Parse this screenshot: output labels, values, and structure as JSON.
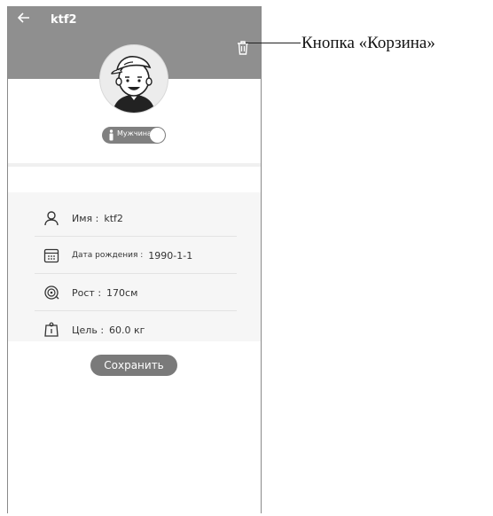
{
  "header": {
    "title": "ktf2",
    "back_icon": "arrow-left-icon",
    "delete_icon": "trash-icon"
  },
  "gender_toggle": {
    "label": "Мужчина"
  },
  "profile": {
    "rows": [
      {
        "label": "Имя :",
        "value": "ktf2",
        "icon": "user-icon"
      },
      {
        "label": "Дата рождения :",
        "value": "1990-1-1",
        "icon": "calendar-icon"
      },
      {
        "label": "Рост :",
        "value": "170см",
        "icon": "height-icon"
      },
      {
        "label": "Цель :",
        "value": "60.0 кг",
        "icon": "weight-icon"
      }
    ]
  },
  "actions": {
    "save_label": "Сохранить"
  },
  "annotation": {
    "delete_button_caption": "Кнопка «Корзина»"
  },
  "colors": {
    "header_bg": "#8f8f8f",
    "button_bg": "#7a7a7a",
    "panel_bg": "#f6f6f6"
  }
}
